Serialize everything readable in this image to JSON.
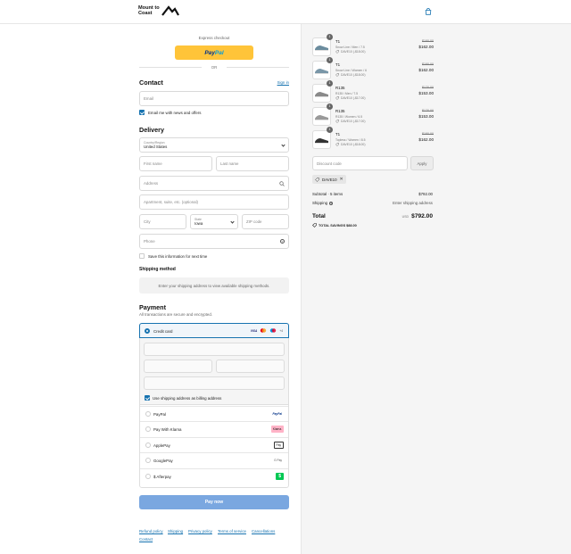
{
  "header": {
    "brand_line1": "Mount to",
    "brand_line2": "Coast"
  },
  "express": {
    "title": "Express checkout",
    "paypal_a": "Pay",
    "paypal_b": "Pal",
    "or": "OR"
  },
  "contact": {
    "heading": "Contact",
    "signin": "Sign in",
    "email_placeholder": "Email",
    "news_label": "Email me with news and offers",
    "news_checked": true
  },
  "delivery": {
    "heading": "Delivery",
    "country_label": "Country/Region",
    "country_value": "United States",
    "first_name": "First name",
    "last_name": "Last name",
    "address": "Address",
    "apartment": "Apartment, suite, etc. (optional)",
    "city": "City",
    "state_label": "State",
    "state_value": "Iowa",
    "zip": "ZIP code",
    "phone": "Phone",
    "save_label": "Save this information for next time"
  },
  "shipping_method": {
    "heading": "Shipping method",
    "note": "Enter your shipping address to view available shipping methods."
  },
  "payment": {
    "heading": "Payment",
    "subtitle": "All transactions are secure and encrypted.",
    "credit_card": "Credit card",
    "card_visa": "VISA",
    "card_more": "+4",
    "billing_same": "Use shipping address as billing address",
    "methods": [
      {
        "name": "PayPal",
        "logo": "PayPal",
        "logo_color": "#003087",
        "logo_bg": "#ffffff"
      },
      {
        "name": "Pay With Klarna",
        "logo": "Klarna.",
        "logo_color": "#111111",
        "logo_bg": "#ffb3c7"
      },
      {
        "name": "ApplePay",
        "logo": "Pay",
        "logo_color": "#111111",
        "logo_bg": "#ffffff"
      },
      {
        "name": "GooglePay",
        "logo": "G Pay",
        "logo_color": "#555555",
        "logo_bg": "#ffffff"
      },
      {
        "name": "$ Afterpay",
        "logo": "$",
        "logo_color": "#ffffff",
        "logo_bg": "#00c853"
      }
    ],
    "pay_now": "Pay now"
  },
  "footer": {
    "links": [
      "Refund policy",
      "Shipping",
      "Privacy policy",
      "Terms of service",
      "Cancellations",
      "Contact"
    ]
  },
  "summary": {
    "items": [
      {
        "qty": "1",
        "name": "T1",
        "variant": "Snow Line / Men / 7.5",
        "discount": "DAVE10 (-$18.00)",
        "old_price": "$180.00",
        "price": "$162.00"
      },
      {
        "qty": "1",
        "name": "T1",
        "variant": "Snow Line / Women / 6",
        "discount": "DAVE10 (-$18.00)",
        "old_price": "$180.00",
        "price": "$162.00"
      },
      {
        "qty": "1",
        "name": "R135",
        "variant": "R135 / Men / 7.5",
        "discount": "DAVE10 (-$17.00)",
        "old_price": "$170.00",
        "price": "$153.00"
      },
      {
        "qty": "1",
        "name": "R135",
        "variant": "R135 / Women / 6.5",
        "discount": "DAVE10 (-$17.00)",
        "old_price": "$170.00",
        "price": "$153.00"
      },
      {
        "qty": "1",
        "name": "T1",
        "variant": "Topless / Women / 8.5",
        "discount": "DAVE10 (-$18.00)",
        "old_price": "$180.00",
        "price": "$162.00"
      }
    ],
    "discount_placeholder": "Discount code",
    "apply": "Apply",
    "applied_code": "DAVE10",
    "subtotal_label": "Subtotal · 5 items",
    "subtotal_value": "$792.00",
    "shipping_label": "Shipping",
    "shipping_value": "Enter shipping address",
    "total_label": "Total",
    "currency": "USD",
    "total_value": "$792.00",
    "savings": "TOTAL SAVINGS  $88.00"
  },
  "colors": {
    "accent": "#1773b0",
    "paypal": "#ffc439",
    "pay_now": "#7aa7e0"
  }
}
